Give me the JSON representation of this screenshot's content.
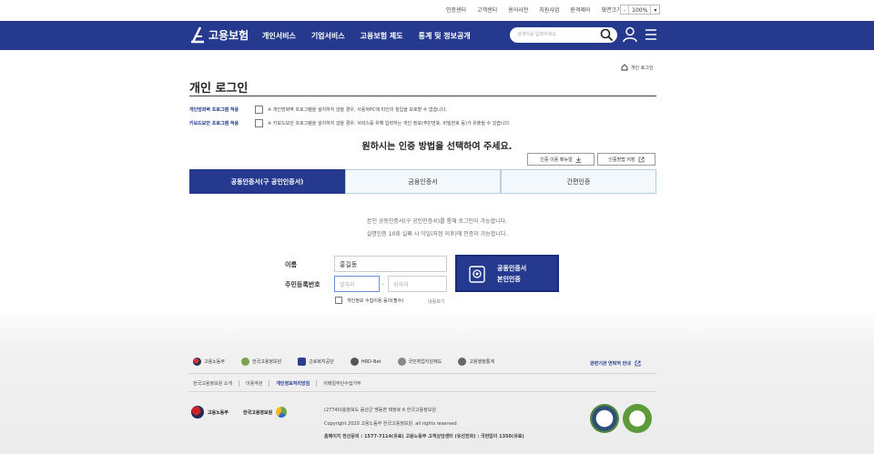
{
  "utility": {
    "links": [
      "인증센터",
      "고객센터",
      "용어사전",
      "지원사업",
      "원격제어",
      "화면크기"
    ],
    "zoom_minus": "-",
    "zoom_value": "100%",
    "zoom_dropdown": "▾"
  },
  "gnb": {
    "logo": "고용보험",
    "menu": [
      "개인서비스",
      "기업서비스",
      "고용보험 제도",
      "통계 및 정보공개"
    ],
    "search_placeholder": "검색어를 입력하세요"
  },
  "breadcrumb": "개인 로그인",
  "page_title": "개인 로그인",
  "options": [
    {
      "label": "개인방화벽 프로그램 적용",
      "note": "※ 개인방화벽 프로그램을 설치하지 않을 경우, 사용자PC에 타인의 침입을 보호할 수 없습니다."
    },
    {
      "label": "키보드보안 프로그램 적용",
      "note": "※ 키보드보안 프로그램을 설치하지 않을 경우, 서비스를 위해 입력하는 개인 정보(주민번호, 비밀번호 등)가 유출될 수 있습니다."
    }
  ],
  "subheading": "원하시는 인증 방법을 선택하여 주세요.",
  "buttons": {
    "manual": "인증 이용 매뉴얼",
    "guide": "인증방법 저장"
  },
  "tabs": [
    "공동인증서(구 공인인증서)",
    "금융인증서",
    "간편인증"
  ],
  "info_lines": [
    "본인 공동인증서(구 공인인증서)를 통해 로그인이 가능합니다.",
    "실명인증 10회 실패 시 익일(자정 이후)에 인증이 가능합니다."
  ],
  "form": {
    "name_label": "이름",
    "name_value": "홍길동",
    "rrn_label": "주민등록번호",
    "rrn_front_placeholder": "앞자리",
    "rrn_back_placeholder": "뒷자리",
    "dash": "-",
    "consent": "개인정보 수집이용 동의(필수)",
    "view": "내용보기",
    "cert_button_line1": "공동인증서",
    "cert_button_line2": "본인인증"
  },
  "family_sites": [
    "고용노동부",
    "한국고용정보원",
    "근로복지공단",
    "HRD-Net",
    "국민취업지원제도",
    "고용행정통계"
  ],
  "related_link": "관련기관 연락처 안내",
  "footer_links": [
    "한국고용정보원 소개",
    "이용약관",
    "개인정보처리방침",
    "이메일무단수집거부"
  ],
  "footer_org": {
    "ministry": "고용노동부",
    "agency": "한국고용정보원"
  },
  "address": "(27740)충청북도 음성군 맹동면 태정로 6 한국고용정보원",
  "copyright": "Copyright 2020 고용노동부 한국고용정보원. all rights reserved",
  "contacts": "홈페이지 전산문의 : 1577-7114(유료)     고용노동부 고객상담센터 (유선전화) : 국번없이 1350(유료)",
  "colors": {
    "brand": "#253a8e",
    "tab_border": "#b9cde0"
  }
}
